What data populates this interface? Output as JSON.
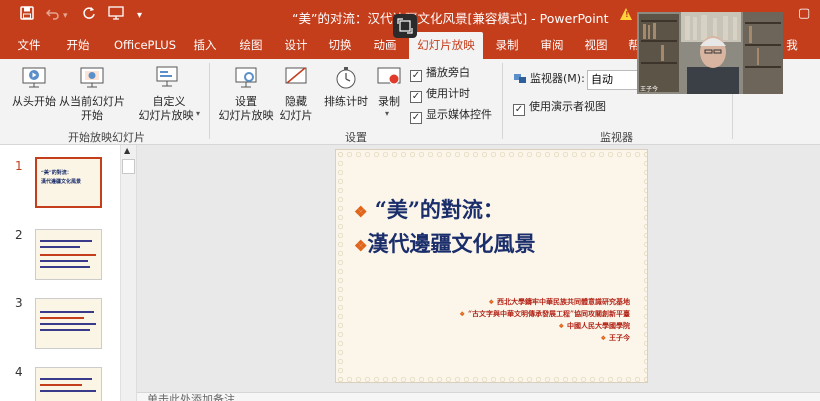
{
  "titlebar": {
    "title": "“美”的对流：汉代边疆文化风景[兼容模式] - PowerPoint",
    "save_icon": "save-icon",
    "undo_icon": "undo-icon",
    "redo_icon": "repeat-icon",
    "custom_icon": "slideshow-from-start-icon",
    "qa_more": "▾",
    "warning_text": "!",
    "share_icon": "screen-share-icon"
  },
  "tabs": [
    {
      "label": "文件"
    },
    {
      "label": "开始"
    },
    {
      "label": "OfficePLUS"
    },
    {
      "label": "插入"
    },
    {
      "label": "绘图"
    },
    {
      "label": "设计"
    },
    {
      "label": "切换"
    },
    {
      "label": "动画"
    },
    {
      "label": "幻灯片放映",
      "active": true
    },
    {
      "label": "录制"
    },
    {
      "label": "审阅"
    },
    {
      "label": "视图"
    },
    {
      "label": "帮"
    },
    {
      "label": "我"
    }
  ],
  "ribbon": {
    "start_group": {
      "from_start": "从头开始",
      "from_current_1": "从当前幻灯片",
      "from_current_2": "开始",
      "custom_1": "自定义",
      "custom_2": "幻灯片放映",
      "label": "开始放映幻灯片"
    },
    "setup_group": {
      "setup_1": "设置",
      "setup_2": "幻灯片放映",
      "hide_1": "隐藏",
      "hide_2": "幻灯片",
      "rehearse": "排练计时",
      "record": "录制",
      "play_narration": "播放旁白",
      "use_timings": "使用计时",
      "show_media": "显示媒体控件",
      "label": "设置"
    },
    "monitor_group": {
      "monitor_label": "监视器(M):",
      "monitor_value": "自动",
      "presenter_view": "使用演示者视图",
      "label": "监视器"
    },
    "checkmark": "✓"
  },
  "thumbnails": {
    "numbers": [
      "1",
      "2",
      "3",
      "4"
    ],
    "slide1_line1": "“美”的對流：",
    "slide1_line2": "漢代邊疆文化風景"
  },
  "slide": {
    "title_line1": "“美”的對流：",
    "title_line2": "漢代邊疆文化風景",
    "credits": [
      "西北大學鑄牢中華民族共同體意識研究基地",
      "“古文字與中華文明傳承發展工程”協同攻關創新平臺",
      "中國人民大學國學院",
      "王子今"
    ]
  },
  "notes": {
    "placeholder": "单击此处添加备注"
  },
  "webcam": {
    "caption": "王子今"
  }
}
